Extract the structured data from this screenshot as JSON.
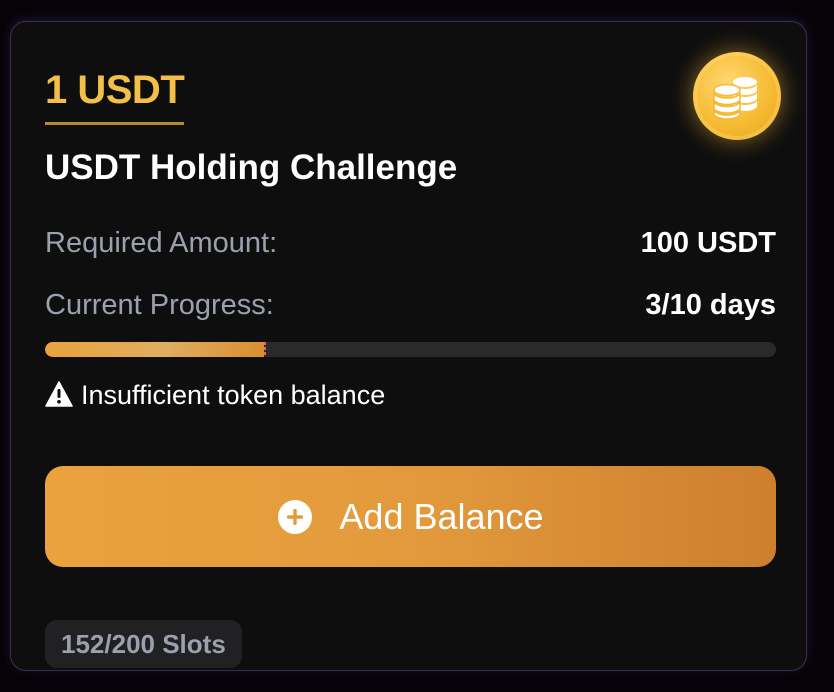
{
  "challenge": {
    "reward": "1 USDT",
    "coin_icon": "coins-icon",
    "title": "USDT Holding Challenge",
    "required_label": "Required Amount:",
    "required_value": "100 USDT",
    "progress_label": "Current Progress:",
    "progress_value": "3/10 days",
    "progress_fraction": 0.3,
    "warning_icon": "warning-icon",
    "warning_text": "Insufficient token balance",
    "add_icon": "plus-circle-icon",
    "add_label": "Add Balance",
    "slots": "152/200 Slots"
  },
  "colors": {
    "accent": "#e9a23e",
    "reward": "#f2bf48",
    "card": "#0e0e0f",
    "muted": "#9aa1ad"
  }
}
